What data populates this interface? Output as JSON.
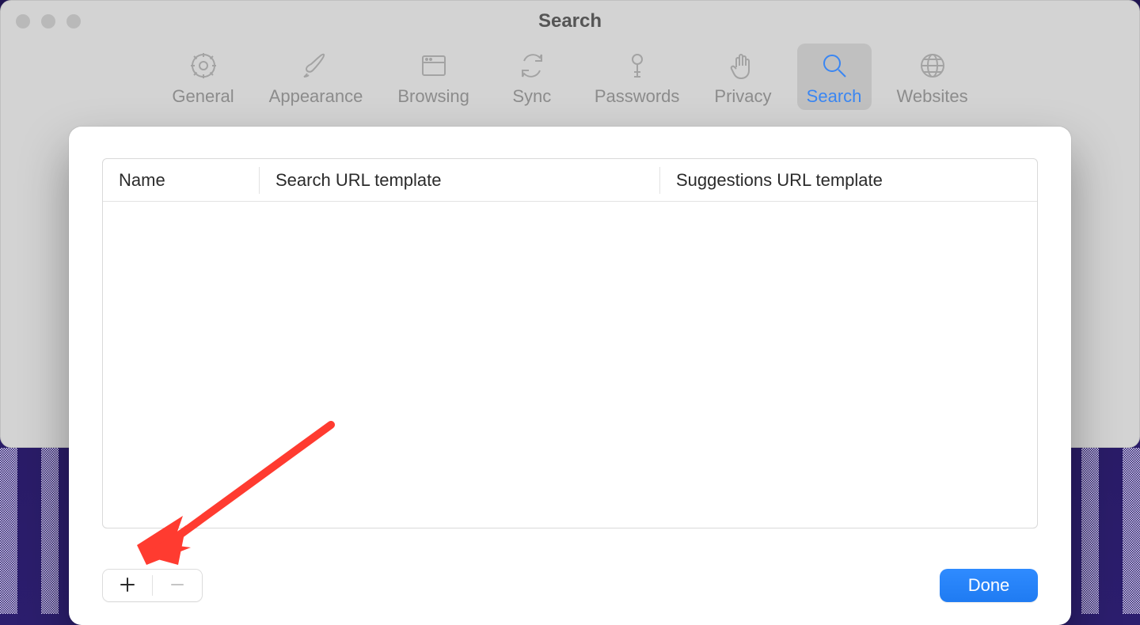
{
  "window": {
    "title": "Search"
  },
  "toolbar": {
    "items": [
      {
        "name": "general",
        "label": "General",
        "active": false
      },
      {
        "name": "appearance",
        "label": "Appearance",
        "active": false
      },
      {
        "name": "browsing",
        "label": "Browsing",
        "active": false
      },
      {
        "name": "sync",
        "label": "Sync",
        "active": false
      },
      {
        "name": "passwords",
        "label": "Passwords",
        "active": false
      },
      {
        "name": "privacy",
        "label": "Privacy",
        "active": false
      },
      {
        "name": "search",
        "label": "Search",
        "active": true
      },
      {
        "name": "websites",
        "label": "Websites",
        "active": false
      }
    ]
  },
  "sheet": {
    "table": {
      "columns": [
        {
          "label": "Name"
        },
        {
          "label": "Search URL template"
        },
        {
          "label": "Suggestions URL template"
        }
      ],
      "rows": []
    },
    "buttons": {
      "add_tooltip": "Add",
      "remove_tooltip": "Remove",
      "done_label": "Done"
    }
  },
  "annotation": {
    "type": "arrow",
    "color": "#ff3b30",
    "points_to": "add-button"
  }
}
